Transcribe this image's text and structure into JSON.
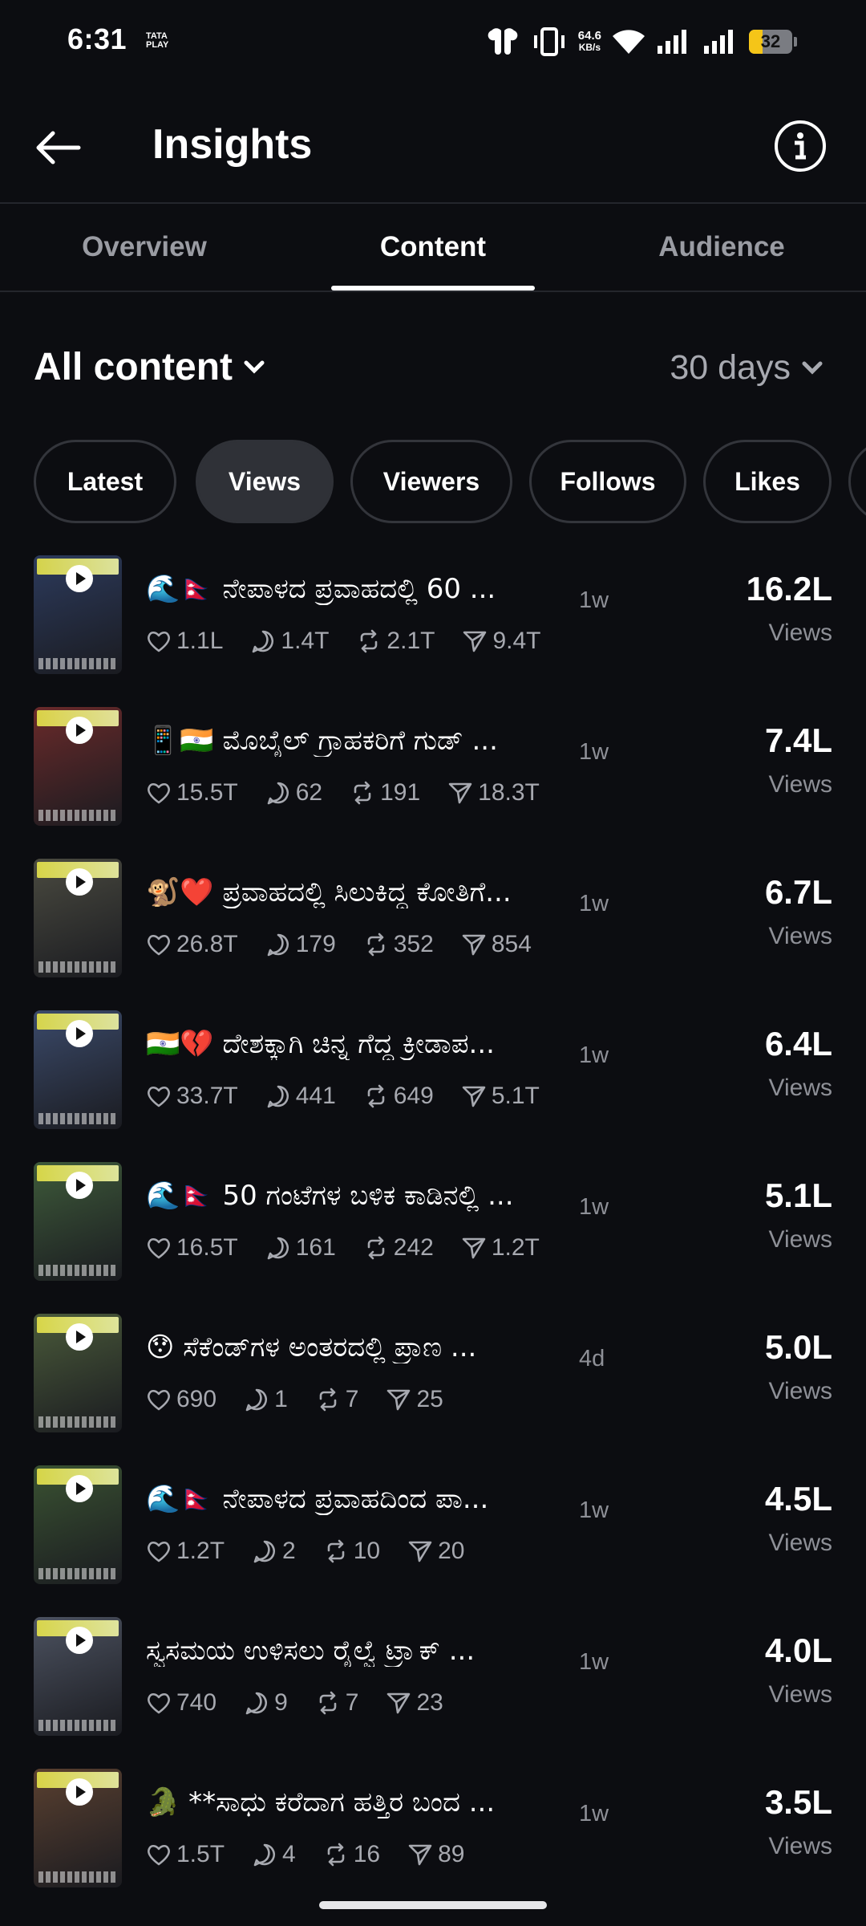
{
  "status_bar": {
    "time": "6:31",
    "carrier": "TATA PLAY",
    "net_speed": "64.6",
    "net_speed_unit": "KB/s",
    "battery": "32",
    "battery_level": 0.32
  },
  "header": {
    "title": "Insights"
  },
  "tabs": [
    {
      "label": "Overview",
      "active": false
    },
    {
      "label": "Content",
      "active": true
    },
    {
      "label": "Audience",
      "active": false
    }
  ],
  "filters": {
    "content_type": "All content",
    "range": "30 days"
  },
  "chips": [
    {
      "label": "Latest",
      "active": false
    },
    {
      "label": "Views",
      "active": true
    },
    {
      "label": "Viewers",
      "active": false
    },
    {
      "label": "Follows",
      "active": false
    },
    {
      "label": "Likes",
      "active": false
    }
  ],
  "posts": [
    {
      "title": "🌊🇳🇵 ನೇಪಾಳದ ಪ್ರವಾಹದಲ್ಲಿ 60 ...",
      "age": "1w",
      "likes": "1.1L",
      "replies": "1.4T",
      "reposts": "2.1T",
      "shares": "9.4T",
      "views": "16.2L",
      "views_label": "Views",
      "thumb_color": "#2c3a5c"
    },
    {
      "title": "📱🇮🇳 ಮೊಬೈಲ್ ಗ್ರಾಹಕರಿಗೆ ಗುಡ್ ...",
      "age": "1w",
      "likes": "15.5T",
      "replies": "62",
      "reposts": "191",
      "shares": "18.3T",
      "views": "7.4L",
      "views_label": "Views",
      "thumb_color": "#6a2a2a"
    },
    {
      "title": "🐒❤️ ಪ್ರವಾಹದಲ್ಲಿ ಸಿಲುಕಿದ್ದ ಕೋತಿಗೆ...",
      "age": "1w",
      "likes": "26.8T",
      "replies": "179",
      "reposts": "352",
      "shares": "854",
      "views": "6.7L",
      "views_label": "Views",
      "thumb_color": "#4a4a40"
    },
    {
      "title": "🇮🇳💔 ದೇಶಕ್ಕಾಗಿ ಚಿನ್ನ ಗೆದ್ದ ಕ್ರೀಡಾಪ...",
      "age": "1w",
      "likes": "33.7T",
      "replies": "441",
      "reposts": "649",
      "shares": "5.1T",
      "views": "6.4L",
      "views_label": "Views",
      "thumb_color": "#3b4a6a"
    },
    {
      "title": "🌊🇳🇵 50 ಗಂಟೆಗಳ ಬಳಿಕ ಕಾಡಿನಲ್ಲಿ ...",
      "age": "1w",
      "likes": "16.5T",
      "replies": "161",
      "reposts": "242",
      "shares": "1.2T",
      "views": "5.1L",
      "views_label": "Views",
      "thumb_color": "#3e5a3a"
    },
    {
      "title": "😯 ಸೆಕೆಂಡ್‌ಗಳ ಅಂತರದಲ್ಲಿ ಪ್ರಾಣ ...",
      "age": "4d",
      "likes": "690",
      "replies": "1",
      "reposts": "7",
      "shares": "25",
      "views": "5.0L",
      "views_label": "Views",
      "thumb_color": "#4a5a3a"
    },
    {
      "title": "🌊🇳🇵 ನೇಪಾಳದ ಪ್ರವಾಹದಿಂದ ಪಾ...",
      "age": "1w",
      "likes": "1.2T",
      "replies": "2",
      "reposts": "10",
      "shares": "20",
      "views": "4.5L",
      "views_label": "Views",
      "thumb_color": "#3a5232"
    },
    {
      "title": "ಸ್ವಸಮಯ ಉಳಿಸಲು ರೈಲ್ವೆ ಟ್ರ್ಯಾಕ್ ...",
      "age": "1w",
      "likes": "740",
      "replies": "9",
      "reposts": "7",
      "shares": "23",
      "views": "4.0L",
      "views_label": "Views",
      "thumb_color": "#4c5260"
    },
    {
      "title": "🐊 **ಸಾಧು ಕರೆದಾಗ ಹತ್ತಿರ ಬಂದ ...",
      "age": "1w",
      "likes": "1.5T",
      "replies": "4",
      "reposts": "16",
      "shares": "89",
      "views": "3.5L",
      "views_label": "Views",
      "thumb_color": "#5a4030"
    }
  ]
}
